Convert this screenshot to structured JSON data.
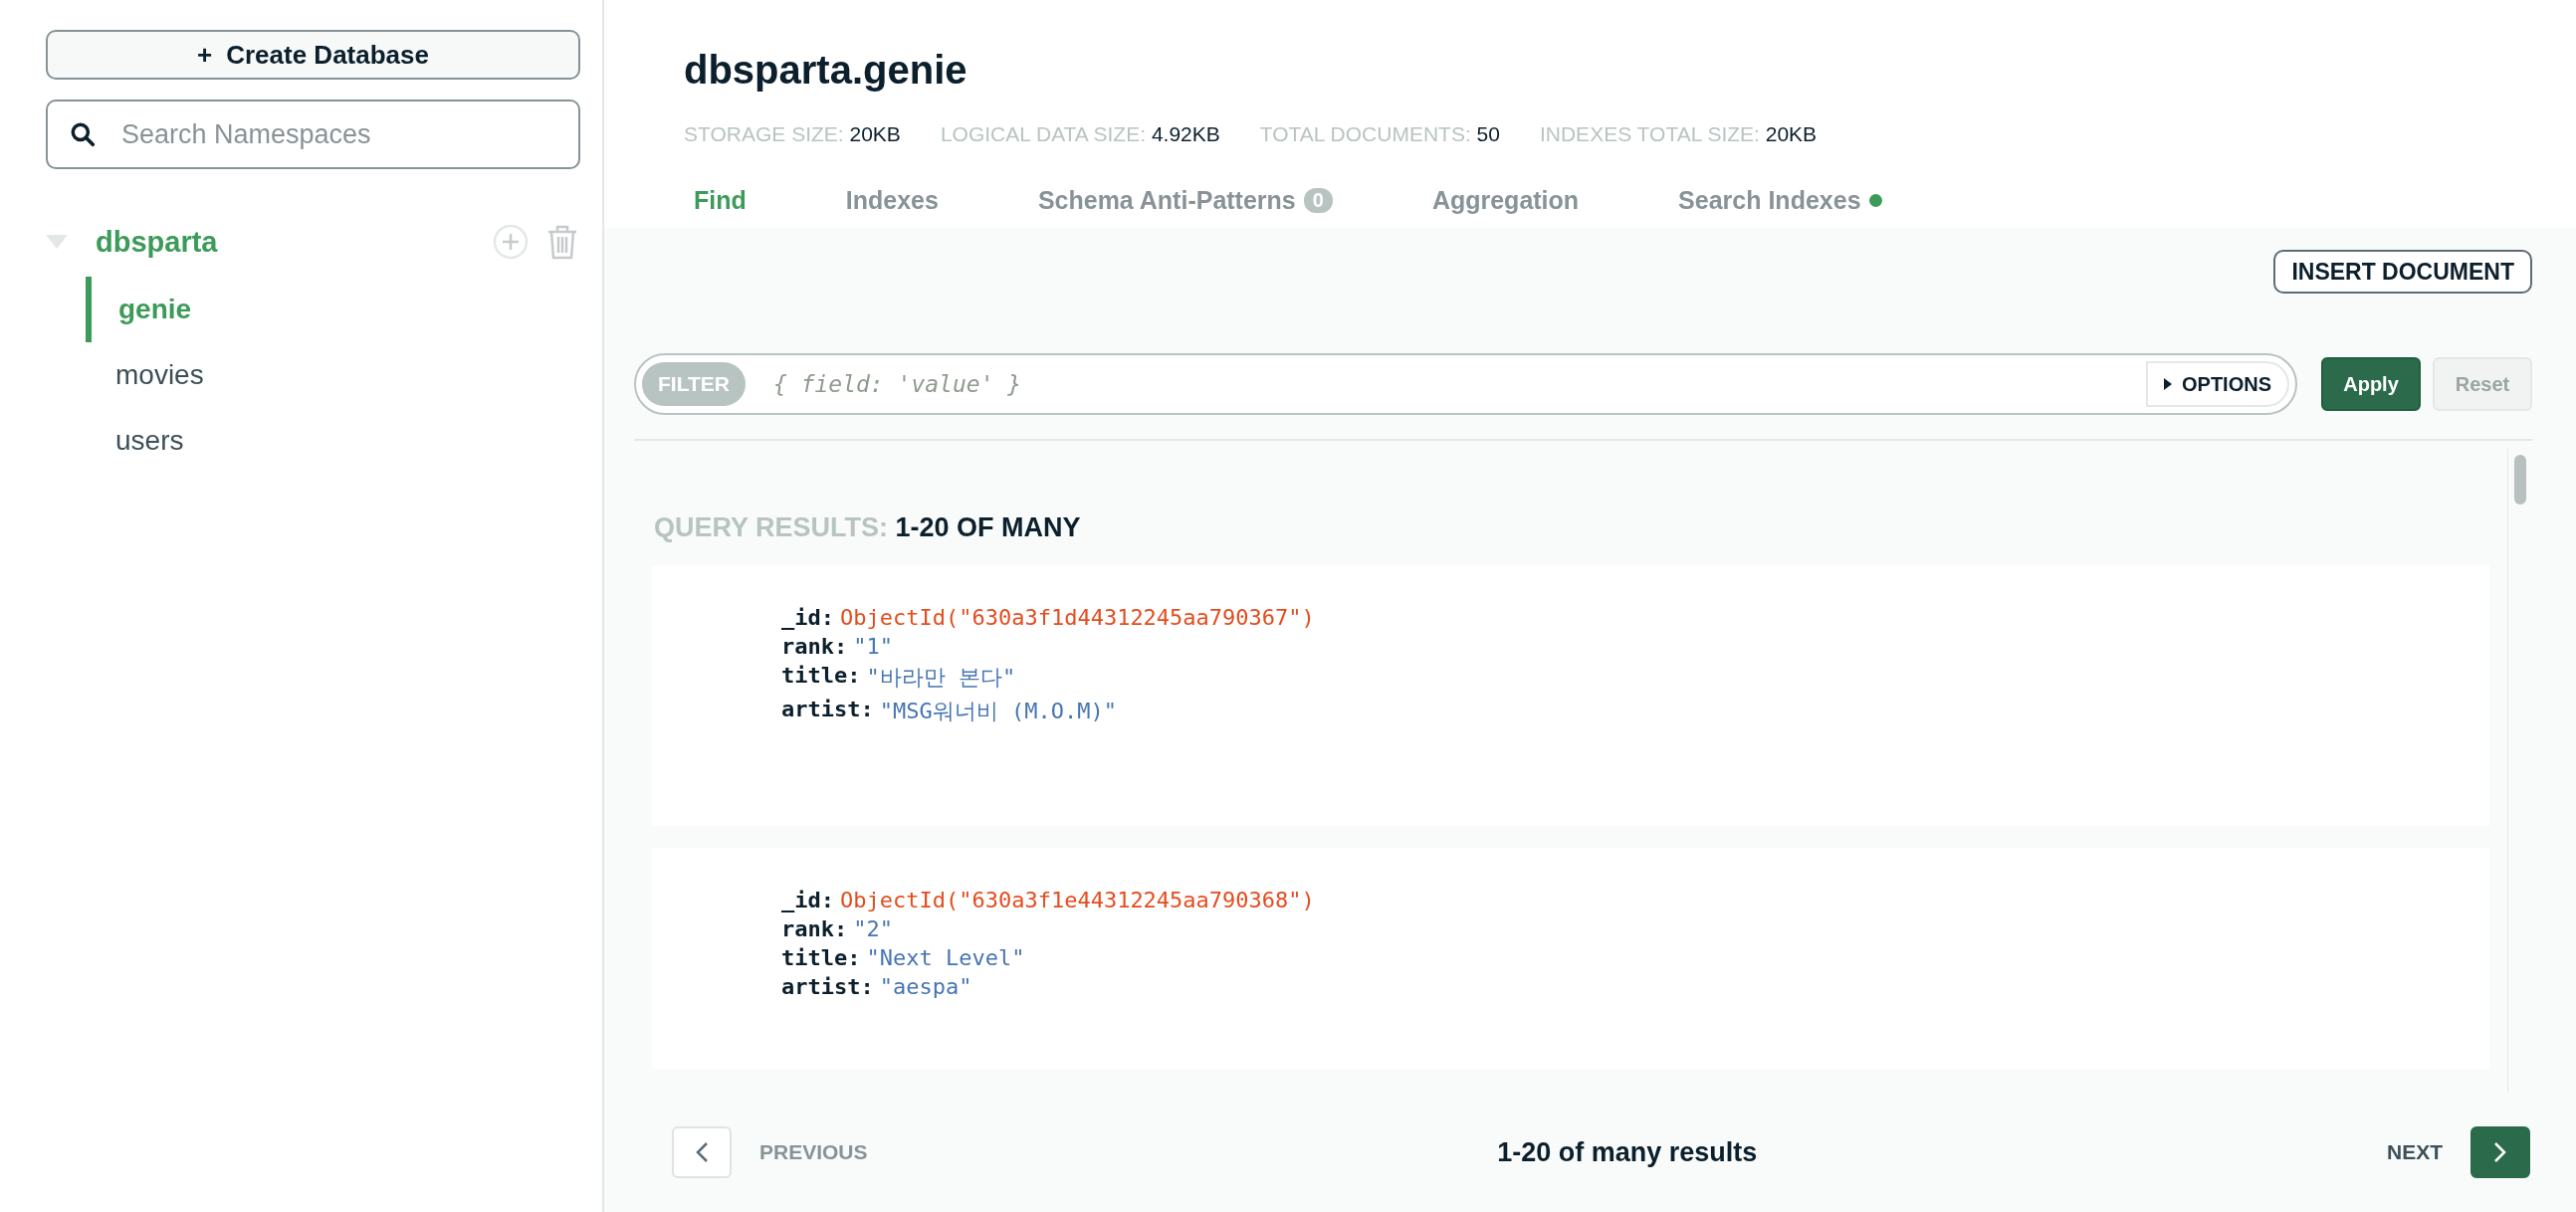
{
  "sidebar": {
    "create_button": "Create Database",
    "create_icon": "+",
    "search": {
      "placeholder": "Search Namespaces"
    },
    "databases": [
      {
        "name": "dbsparta",
        "expanded": true,
        "children": [
          {
            "name": "genie",
            "selected": true
          },
          {
            "name": "movies",
            "selected": false
          },
          {
            "name": "users",
            "selected": false
          }
        ]
      }
    ]
  },
  "header": {
    "title": "dbsparta.genie",
    "stats": [
      {
        "label": "STORAGE SIZE:",
        "value": "20KB"
      },
      {
        "label": "LOGICAL DATA SIZE:",
        "value": "4.92KB"
      },
      {
        "label": "TOTAL DOCUMENTS:",
        "value": "50"
      },
      {
        "label": "INDEXES TOTAL SIZE:",
        "value": "20KB"
      }
    ],
    "tabs": [
      {
        "label": "Find",
        "selected": true
      },
      {
        "label": "Indexes",
        "selected": false
      },
      {
        "label": "Schema Anti-Patterns",
        "selected": false,
        "badge": "0"
      },
      {
        "label": "Aggregation",
        "selected": false
      },
      {
        "label": "Search Indexes",
        "selected": false,
        "status_dot": true
      }
    ]
  },
  "toolbar": {
    "insert_button": "INSERT DOCUMENT",
    "filter": {
      "tag": "FILTER",
      "placeholder": "{ field: 'value' }",
      "options_button": "OPTIONS"
    },
    "apply_button": {
      "label": "Apply",
      "disabled": false
    },
    "reset_button": {
      "label": "Reset",
      "disabled": true
    }
  },
  "results": {
    "label": "QUERY RESULTS:",
    "range": "1-20 OF MANY",
    "documents": [
      {
        "fields": [
          {
            "key": "_id:",
            "value": "ObjectId(\"630a3f1d44312245aa790367\")",
            "kind": "objectid"
          },
          {
            "key": "rank:",
            "value": "\"1\"",
            "kind": "string"
          },
          {
            "key": "title:",
            "value": "\"바라만 본다\"",
            "kind": "string"
          },
          {
            "key": "artist:",
            "value": "\"MSG워너비 (M.O.M)\"",
            "kind": "string"
          }
        ]
      },
      {
        "fields": [
          {
            "key": "_id:",
            "value": "ObjectId(\"630a3f1e44312245aa790368\")",
            "kind": "objectid"
          },
          {
            "key": "rank:",
            "value": "\"2\"",
            "kind": "string"
          },
          {
            "key": "title:",
            "value": "\"Next Level\"",
            "kind": "string"
          },
          {
            "key": "artist:",
            "value": "\"aespa\"",
            "kind": "string"
          }
        ]
      }
    ]
  },
  "pagination": {
    "previous": {
      "label": "PREVIOUS",
      "disabled": true
    },
    "summary": "1-20 of many results",
    "next": {
      "label": "NEXT",
      "disabled": false
    }
  }
}
